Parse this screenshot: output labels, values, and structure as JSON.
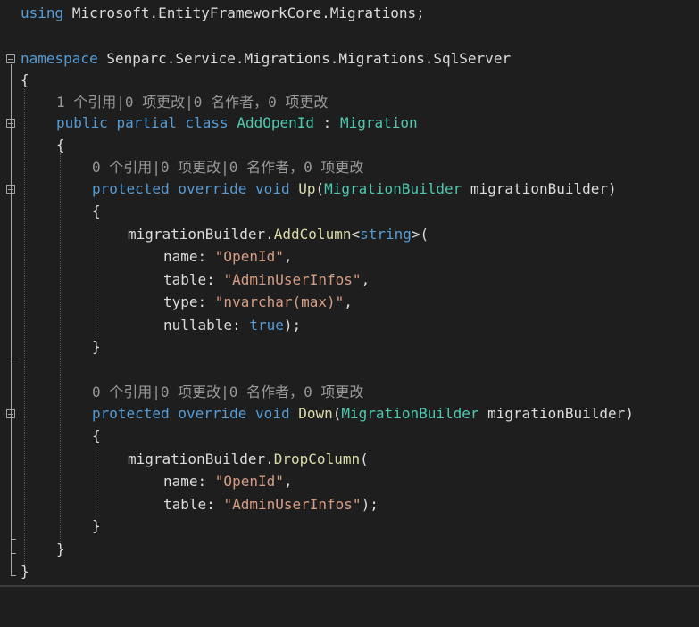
{
  "colors": {
    "background": "#1e1e1e",
    "keyword": "#569cd6",
    "type": "#4ec9b0",
    "method": "#dcdcaa",
    "string": "#d69d85",
    "codelens": "#999999",
    "text": "#dcdcdc"
  },
  "code": {
    "using_kw": "using",
    "using_ns": " Microsoft.EntityFrameworkCore.Migrations;",
    "namespace_kw": "namespace",
    "namespace_name": " Senparc.Service.Migrations.Migrations.SqlServer",
    "open_brace": "{",
    "close_brace": "}",
    "codelens_class": "1 个引用|0 项更改|0 名作者，0 项更改",
    "class_public": "public",
    "class_partial": "partial",
    "class_kw": "class",
    "class_name": "AddOpenId",
    "class_colon": " : ",
    "class_base": "Migration",
    "codelens_up": "0 个引用|0 项更改|0 名作者，0 项更改",
    "protected_kw": "protected",
    "override_kw": "override",
    "void_kw": "void",
    "up_name": "Up",
    "param_open": "(",
    "param_type": "MigrationBuilder",
    "param_name": " migrationBuilder)",
    "mb": "migrationBuilder.",
    "add_column": "AddColumn",
    "generic_open": "<",
    "string_kw": "string",
    "generic_close": ">(",
    "name_label": "name: ",
    "name_value": "\"OpenId\"",
    "comma": ",",
    "table_label": "table: ",
    "table_value": "\"AdminUserInfos\"",
    "type_label": "type: ",
    "type_value": "\"nvarchar(max)\"",
    "nullable_label": "nullable: ",
    "true_kw": "true",
    "end_call": ");",
    "codelens_down": "0 个引用|0 项更改|0 名作者，0 项更改",
    "down_name": "Down",
    "drop_column": "DropColumn",
    "call_open": "("
  }
}
